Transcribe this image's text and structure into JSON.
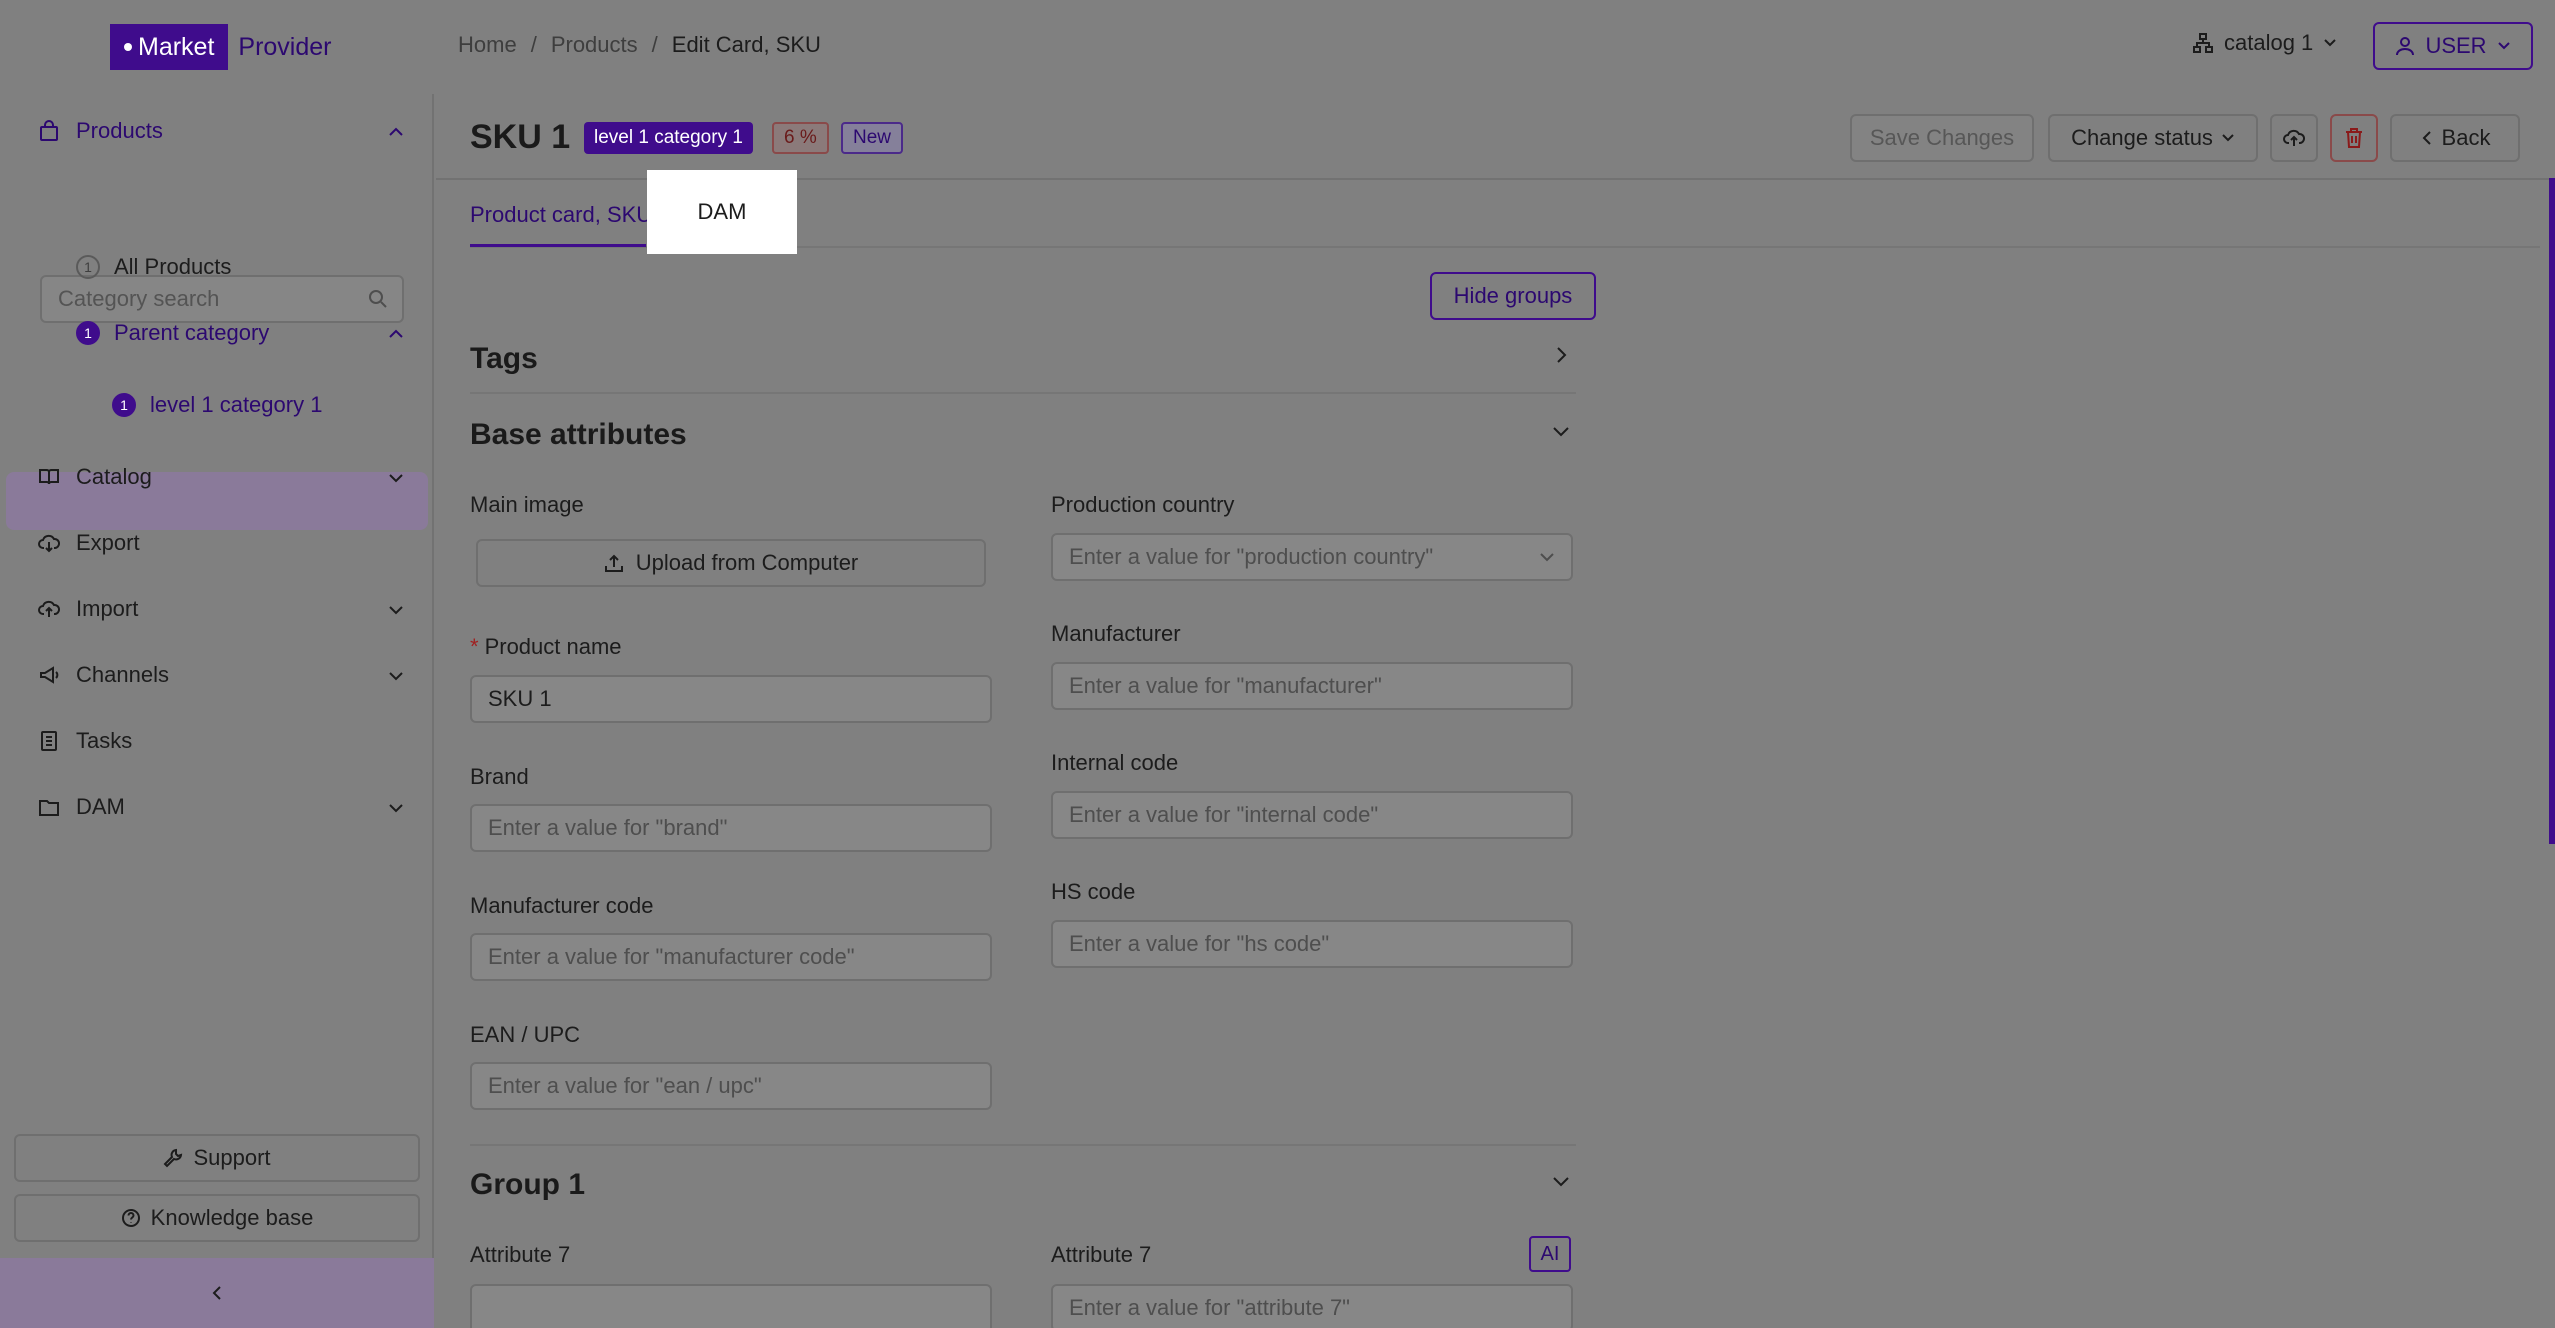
{
  "brand": {
    "logo_left": "Market",
    "logo_right": "Provider"
  },
  "breadcrumb": {
    "home": "Home",
    "sep1": "/",
    "products": "Products",
    "sep2": "/",
    "current": "Edit Card, SKU"
  },
  "header_right": {
    "catalog": "catalog 1",
    "user": "USER"
  },
  "sidebar": {
    "products": "Products",
    "search_placeholder": "Category search",
    "all_products": {
      "count": "1",
      "label": "All Products"
    },
    "parent_category": {
      "count": "1",
      "label": "Parent category"
    },
    "level1": {
      "count": "1",
      "label": "level 1 category 1"
    },
    "catalog": "Catalog",
    "export": "Export",
    "import": "Import",
    "channels": "Channels",
    "tasks": "Tasks",
    "dam": "DAM",
    "support": "Support",
    "knowledge": "Knowledge base"
  },
  "card": {
    "title": "SKU 1",
    "badge_category": "level 1 category 1",
    "badge_percent": "6 %",
    "badge_status": "New",
    "save": "Save Changes",
    "change_status": "Change status",
    "back": "Back"
  },
  "tabs": {
    "product_card": "Product card, SKU",
    "dam": "DAM"
  },
  "hide_groups": "Hide groups",
  "sections": {
    "tags": "Tags",
    "base": "Base attributes",
    "group1": "Group 1"
  },
  "fields": {
    "main_image": "Main image",
    "upload": "Upload from Computer",
    "product_name": "Product name",
    "product_name_required": "*",
    "product_name_value": "SKU 1",
    "brand": "Brand",
    "brand_ph": "Enter a value for \"brand\"",
    "manufacturer_code": "Manufacturer code",
    "manufacturer_code_ph": "Enter a value for \"manufacturer code\"",
    "ean": "EAN / UPC",
    "ean_ph": "Enter a value for \"ean / upc\"",
    "production_country": "Production country",
    "production_country_ph": "Enter a value for \"production country\"",
    "manufacturer": "Manufacturer",
    "manufacturer_ph": "Enter a value for \"manufacturer\"",
    "internal_code": "Internal code",
    "internal_code_ph": "Enter a value for \"internal code\"",
    "hs_code": "HS code",
    "hs_code_ph": "Enter a value for \"hs code\"",
    "attr7_left": "Attribute 7",
    "attr7_right": "Attribute 7",
    "attr7_ph": "Enter a value for \"attribute 7\"",
    "ai": "AI"
  },
  "colors": {
    "accent": "#3f0c8c",
    "overlay": "#808080",
    "highlight": "#ffffff"
  }
}
